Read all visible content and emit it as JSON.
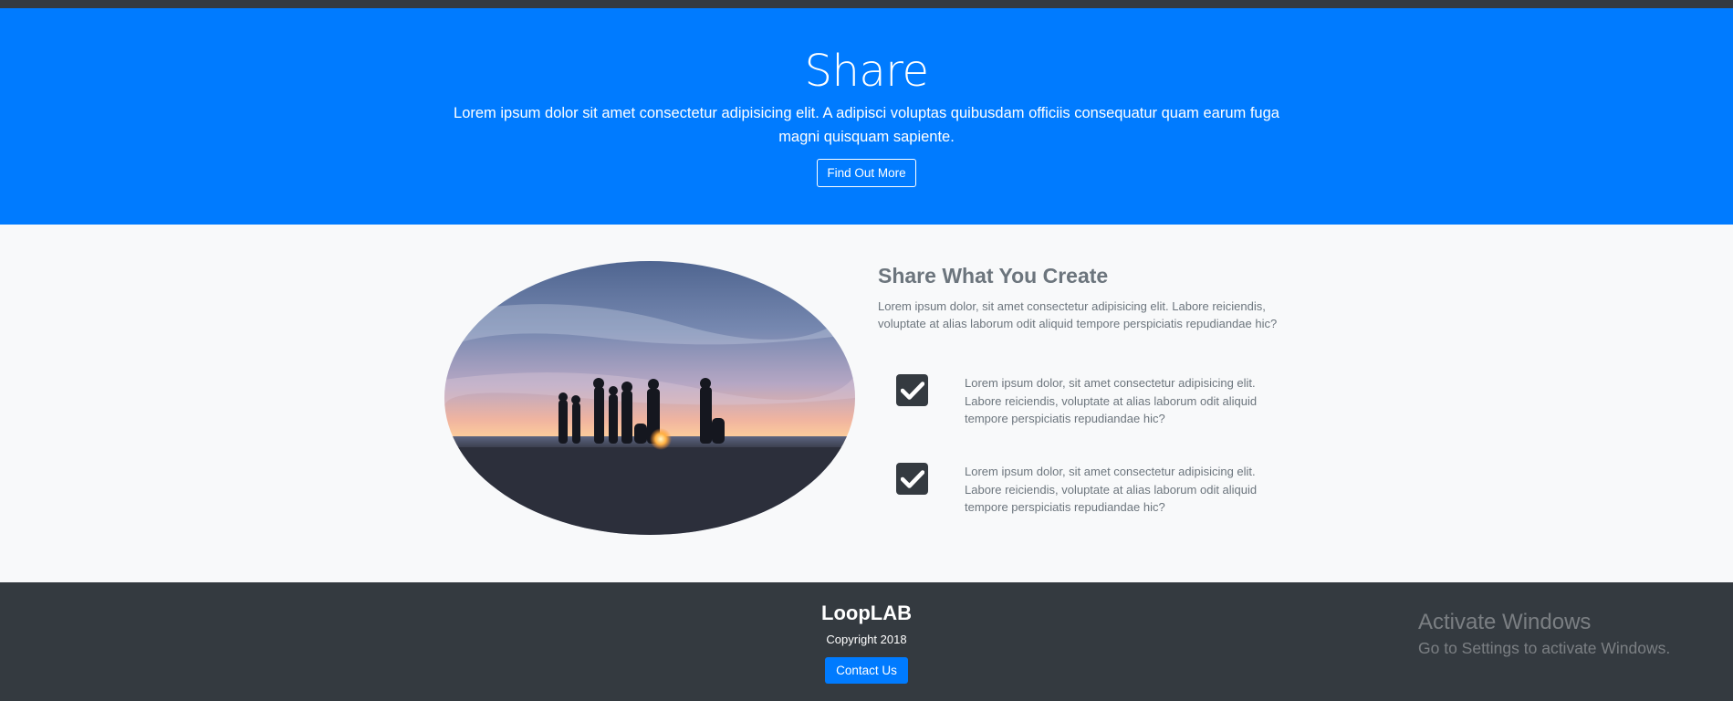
{
  "hero": {
    "title": "Share",
    "lead": "Lorem ipsum dolor sit amet consectetur adipisicing elit. A adipisci voluptas quibusdam officiis consequatur quam earum fuga magni quisquam sapiente.",
    "button": "Find Out More"
  },
  "feature": {
    "title": "Share What You Create",
    "intro": "Lorem ipsum dolor, sit amet consectetur adipisicing elit. Labore reiciendis, voluptate at alias laborum odit aliquid tempore perspiciatis repudiandae hic?",
    "items": [
      {
        "text": "Lorem ipsum dolor, sit amet consectetur adipisicing elit. Labore reiciendis, voluptate at alias laborum odit aliquid tempore perspiciatis repudiandae hic?",
        "checked": true
      },
      {
        "text": "Lorem ipsum dolor, sit amet consectetur adipisicing elit. Labore reiciendis, voluptate at alias laborum odit aliquid tempore perspiciatis repudiandae hic?",
        "checked": true
      }
    ]
  },
  "footer": {
    "brand": "LoopLAB",
    "copyright": "Copyright 2018",
    "contact": "Contact Us"
  },
  "watermark": {
    "line1": "Activate Windows",
    "line2": "Go to Settings to activate Windows."
  },
  "colors": {
    "primary": "#007bff",
    "dark": "#343a40",
    "light": "#f8f9fa",
    "muted": "#6c757d"
  },
  "icons": {
    "check": "check-square-icon"
  }
}
